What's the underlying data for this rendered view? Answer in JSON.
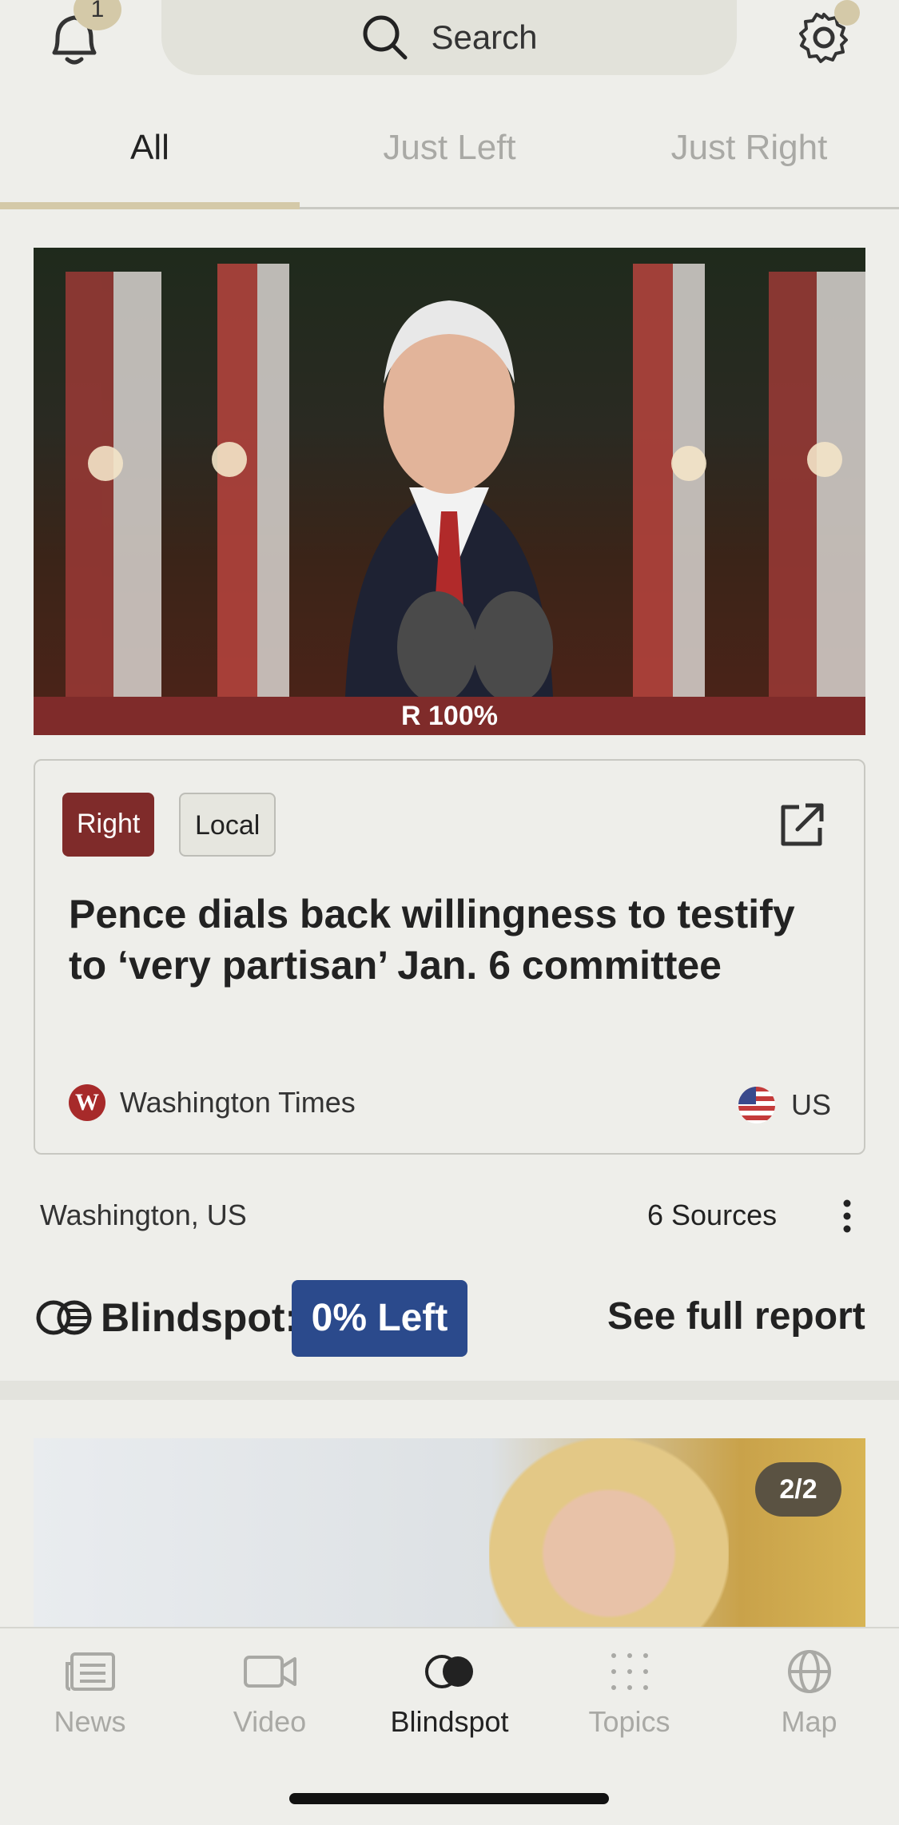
{
  "header": {
    "notification_count": "1",
    "search_label": "Search"
  },
  "tabs": [
    {
      "label": "All",
      "active": true
    },
    {
      "label": "Just Left",
      "active": false
    },
    {
      "label": "Just Right",
      "active": false
    }
  ],
  "story": {
    "bias_bar": "R 100%",
    "bias_percent_right": 100,
    "tags": {
      "bias": "Right",
      "scope": "Local"
    },
    "headline": "Pence dials back willingness to testify to ‘very partisan’ Jan. 6 committee",
    "source_name": "Washington Times",
    "source_logo_letter": "W",
    "country": "US",
    "location": "Washington, US",
    "sources_count": "6 Sources",
    "blindspot_label": "Blindspot:",
    "blindspot_value": "0% Left",
    "see_report": "See full report"
  },
  "next_story": {
    "image_count": "2/2"
  },
  "bottom_nav": [
    {
      "label": "News",
      "icon": "news-icon",
      "active": false
    },
    {
      "label": "Video",
      "icon": "video-icon",
      "active": false
    },
    {
      "label": "Blindspot",
      "icon": "blindspot-icon",
      "active": true
    },
    {
      "label": "Topics",
      "icon": "topics-icon",
      "active": false
    },
    {
      "label": "Map",
      "icon": "globe-icon",
      "active": false
    }
  ],
  "colors": {
    "right": "#7F2B2A",
    "left": "#2B4A8C",
    "accent": "#D4C9A8",
    "background": "#EEEEEA"
  }
}
